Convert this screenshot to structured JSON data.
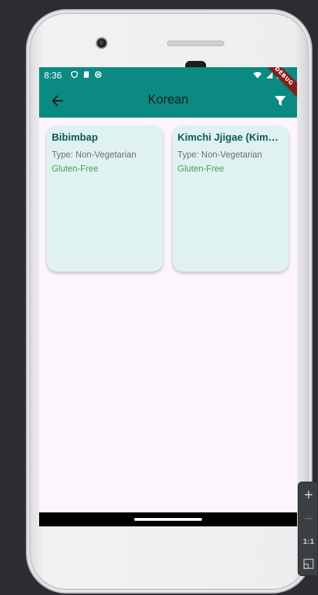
{
  "status_bar": {
    "time": "8:36"
  },
  "app_bar": {
    "title": "Korean"
  },
  "debug_banner": "DEBUG",
  "meals": [
    {
      "title": "Bibimbap",
      "type": "Type: Non-Vegetarian",
      "tag": "Gluten-Free"
    },
    {
      "title": "Kimchi Jjigae (Kimchi Stew)",
      "type": "Type: Non-Vegetarian",
      "tag": "Gluten-Free"
    }
  ],
  "side_panel": {
    "one_to_one": "1:1"
  },
  "colors": {
    "app_bar": "#0a8a80",
    "card": "#e0f1f1",
    "title": "#0d5a55",
    "tag": "#44a448"
  }
}
